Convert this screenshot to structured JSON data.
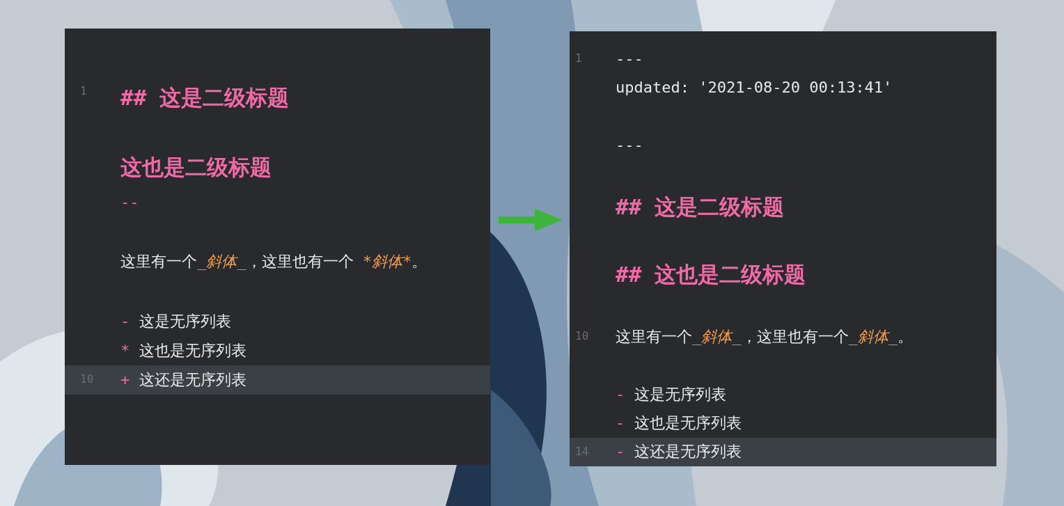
{
  "editors": [
    {
      "lines": [
        {
          "kind": "heading",
          "number": "1",
          "current": false,
          "segments": [
            {
              "kind": "mark",
              "text": "## 这是二级标题"
            }
          ]
        },
        {
          "kind": "blank",
          "current": false
        },
        {
          "kind": "heading",
          "current": false,
          "segments": [
            {
              "kind": "mark",
              "text": "这也是二级标题"
            }
          ]
        },
        {
          "kind": "rule",
          "current": false,
          "segments": [
            {
              "kind": "mark",
              "text": "--"
            }
          ]
        },
        {
          "kind": "blank",
          "current": false
        },
        {
          "kind": "text",
          "current": false,
          "segments": [
            {
              "kind": "plain",
              "text": "这里有一个"
            },
            {
              "kind": "italic",
              "text": "_斜体_"
            },
            {
              "kind": "plain",
              "text": "，这里也有一个 "
            },
            {
              "kind": "italic",
              "text": "*斜体*"
            },
            {
              "kind": "plain",
              "text": "。"
            }
          ]
        },
        {
          "kind": "blank",
          "current": false
        },
        {
          "kind": "text",
          "current": false,
          "segments": [
            {
              "kind": "mark",
              "text": "- "
            },
            {
              "kind": "plain",
              "text": "这是无序列表"
            }
          ]
        },
        {
          "kind": "text",
          "current": false,
          "segments": [
            {
              "kind": "mark",
              "text": "* "
            },
            {
              "kind": "plain",
              "text": "这也是无序列表"
            }
          ]
        },
        {
          "kind": "text",
          "number": "10",
          "current": true,
          "segments": [
            {
              "kind": "mark",
              "text": "+ "
            },
            {
              "kind": "plain",
              "text": "这还是无序列表"
            }
          ]
        }
      ]
    },
    {
      "lines": [
        {
          "kind": "text",
          "number": "1",
          "current": false,
          "segments": [
            {
              "kind": "plain",
              "text": "---"
            }
          ]
        },
        {
          "kind": "text",
          "current": false,
          "segments": [
            {
              "kind": "plain",
              "text": "updated: '2021-08-20 00:13:41'"
            }
          ]
        },
        {
          "kind": "blank",
          "current": false
        },
        {
          "kind": "text",
          "current": false,
          "segments": [
            {
              "kind": "plain",
              "text": "---"
            }
          ]
        },
        {
          "kind": "blank",
          "current": false
        },
        {
          "kind": "heading",
          "current": false,
          "segments": [
            {
              "kind": "mark",
              "text": "## 这是二级标题"
            }
          ]
        },
        {
          "kind": "blank",
          "current": false
        },
        {
          "kind": "heading",
          "current": false,
          "segments": [
            {
              "kind": "mark",
              "text": "## 这也是二级标题"
            }
          ]
        },
        {
          "kind": "blank",
          "current": false
        },
        {
          "kind": "text",
          "number": "10",
          "current": false,
          "segments": [
            {
              "kind": "plain",
              "text": "这里有一个"
            },
            {
              "kind": "italic",
              "text": "_斜体_"
            },
            {
              "kind": "plain",
              "text": "，这里也有一个"
            },
            {
              "kind": "italic",
              "text": "_斜体_"
            },
            {
              "kind": "plain",
              "text": "。"
            }
          ]
        },
        {
          "kind": "blank",
          "current": false
        },
        {
          "kind": "text",
          "current": false,
          "segments": [
            {
              "kind": "mark",
              "text": "- "
            },
            {
              "kind": "plain",
              "text": "这是无序列表"
            }
          ]
        },
        {
          "kind": "text",
          "current": false,
          "segments": [
            {
              "kind": "mark",
              "text": "- "
            },
            {
              "kind": "plain",
              "text": "这也是无序列表"
            }
          ]
        },
        {
          "kind": "text",
          "number": "14",
          "current": true,
          "segments": [
            {
              "kind": "mark",
              "text": "- "
            },
            {
              "kind": "plain",
              "text": "这还是无序列表"
            }
          ]
        }
      ]
    }
  ]
}
